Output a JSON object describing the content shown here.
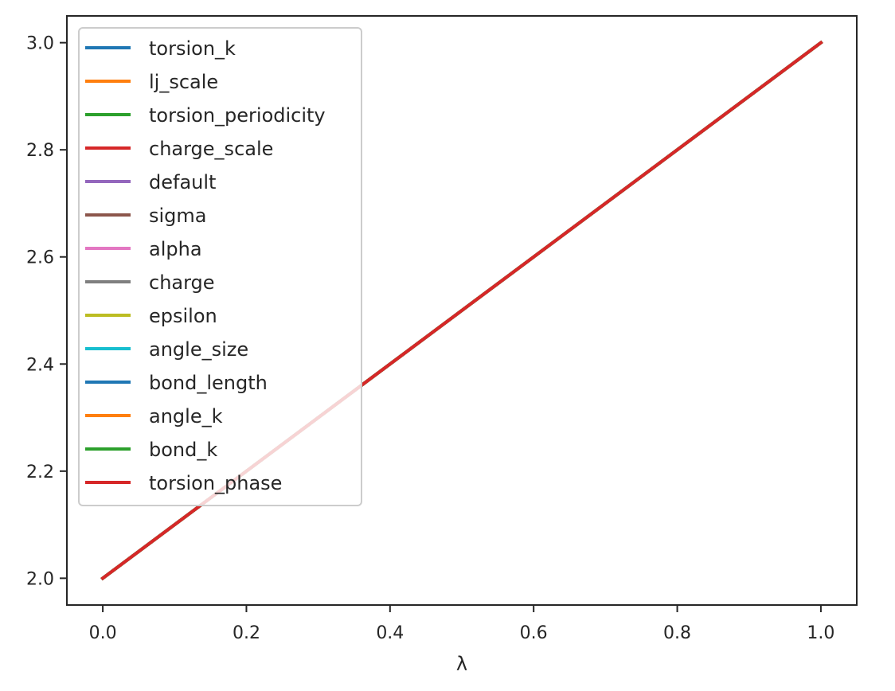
{
  "chart_data": {
    "type": "line",
    "title": "",
    "xlabel": "λ",
    "ylabel": "",
    "xlim": [
      -0.05,
      1.05
    ],
    "ylim": [
      1.95,
      3.05
    ],
    "grid": false,
    "legend_position": "upper-left",
    "xticks": [
      0.0,
      0.2,
      0.4,
      0.6,
      0.8,
      1.0
    ],
    "xtick_labels": [
      "0.0",
      "0.2",
      "0.4",
      "0.6",
      "0.8",
      "1.0"
    ],
    "yticks": [
      2.0,
      2.2,
      2.4,
      2.6,
      2.8,
      3.0
    ],
    "ytick_labels": [
      "2.0",
      "2.2",
      "2.4",
      "2.6",
      "2.8",
      "3.0"
    ],
    "x": [
      0.0,
      1.0
    ],
    "series": [
      {
        "name": "torsion_k",
        "color": "#1f77b4",
        "values": [
          2.0,
          3.0
        ]
      },
      {
        "name": "lj_scale",
        "color": "#ff7f0e",
        "values": [
          2.0,
          3.0
        ]
      },
      {
        "name": "torsion_periodicity",
        "color": "#2ca02c",
        "values": [
          2.0,
          3.0
        ]
      },
      {
        "name": "charge_scale",
        "color": "#d62728",
        "values": [
          2.0,
          3.0
        ]
      },
      {
        "name": "default",
        "color": "#9467bd",
        "values": [
          2.0,
          3.0
        ]
      },
      {
        "name": "sigma",
        "color": "#8c564b",
        "values": [
          2.0,
          3.0
        ]
      },
      {
        "name": "alpha",
        "color": "#e377c2",
        "values": [
          2.0,
          3.0
        ]
      },
      {
        "name": "charge",
        "color": "#7f7f7f",
        "values": [
          2.0,
          3.0
        ]
      },
      {
        "name": "epsilon",
        "color": "#bcbd22",
        "values": [
          2.0,
          3.0
        ]
      },
      {
        "name": "angle_size",
        "color": "#17becf",
        "values": [
          2.0,
          3.0
        ]
      },
      {
        "name": "bond_length",
        "color": "#1f77b4",
        "values": [
          2.0,
          3.0
        ]
      },
      {
        "name": "angle_k",
        "color": "#ff7f0e",
        "values": [
          2.0,
          3.0
        ]
      },
      {
        "name": "bond_k",
        "color": "#2ca02c",
        "values": [
          2.0,
          3.0
        ]
      },
      {
        "name": "torsion_phase",
        "color": "#d62728",
        "values": [
          2.0,
          3.0
        ]
      }
    ]
  }
}
